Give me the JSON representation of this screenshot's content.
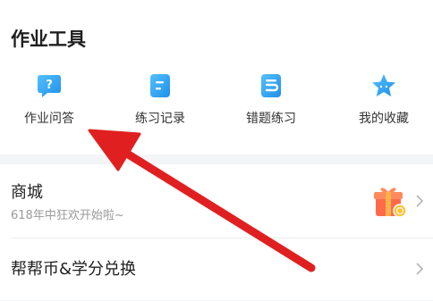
{
  "tools_section": {
    "title": "作业工具",
    "items": [
      {
        "label": "作业问答",
        "icon": "question-bubble-icon"
      },
      {
        "label": "练习记录",
        "icon": "record-list-icon"
      },
      {
        "label": "错题练习",
        "icon": "wrong-question-icon"
      },
      {
        "label": "我的收藏",
        "icon": "star-favorite-icon"
      }
    ],
    "icon_color": "#2ba0f5"
  },
  "mall_row": {
    "title": "商城",
    "subtitle": "618年中狂欢开始啦~",
    "icon": "gift-box-icon",
    "icon_color": "#ff5a3c"
  },
  "coin_row": {
    "title": "帮帮币&学分兑换"
  },
  "annotation": {
    "color": "#e02020",
    "points_to": "作业问答"
  }
}
